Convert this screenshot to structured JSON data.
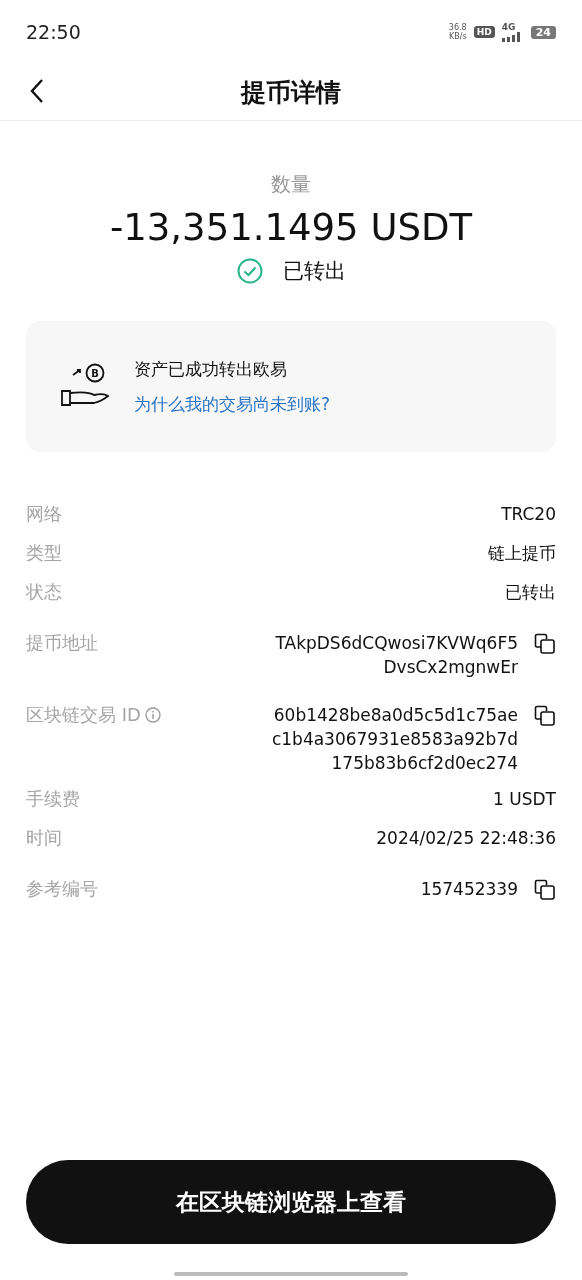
{
  "status_bar": {
    "time": "22:50",
    "speed": "36.8",
    "speed_unit": "KB/s",
    "hd": "HD",
    "network": "4G",
    "battery": "24"
  },
  "header": {
    "title": "提币详情"
  },
  "summary": {
    "label": "数量",
    "amount": "-13,351.1495 USDT",
    "status": "已转出",
    "done": true
  },
  "notice": {
    "coin": "B",
    "text": "资产已成功转出欧易",
    "link": "为什么我的交易尚未到账?"
  },
  "details": [
    {
      "label": "网络",
      "lines": [
        "TRC20"
      ],
      "kind": "plain",
      "info": false
    },
    {
      "label": "类型",
      "lines": [
        "链上提币"
      ],
      "kind": "plain",
      "info": false
    },
    {
      "label": "状态",
      "lines": [
        "已转出"
      ],
      "kind": "plain",
      "info": false
    },
    {
      "label": "提币地址",
      "lines": [
        "TAkpDS6dCQwosi7KVWq6F5",
        "DvsCx2mgnwEr"
      ],
      "kind": "copy",
      "info": false
    },
    {
      "label": "区块链交易 ID",
      "lines": [
        "60b1428be8a0d5c5d1c75ae",
        "c1b4a3067931e8583a92b7d",
        "175b83b6cf2d0ec274"
      ],
      "kind": "copy",
      "info": true
    },
    {
      "label": "手续费",
      "lines": [
        "1 USDT"
      ],
      "kind": "plain",
      "info": false
    },
    {
      "label": "时间",
      "lines": [
        "2024/02/25 22:48:36"
      ],
      "kind": "plain",
      "info": false
    },
    {
      "label": "参考编号",
      "lines": [
        "157452339"
      ],
      "kind": "copy",
      "info": false
    }
  ],
  "button": {
    "label": "在区块链浏览器上查看"
  }
}
